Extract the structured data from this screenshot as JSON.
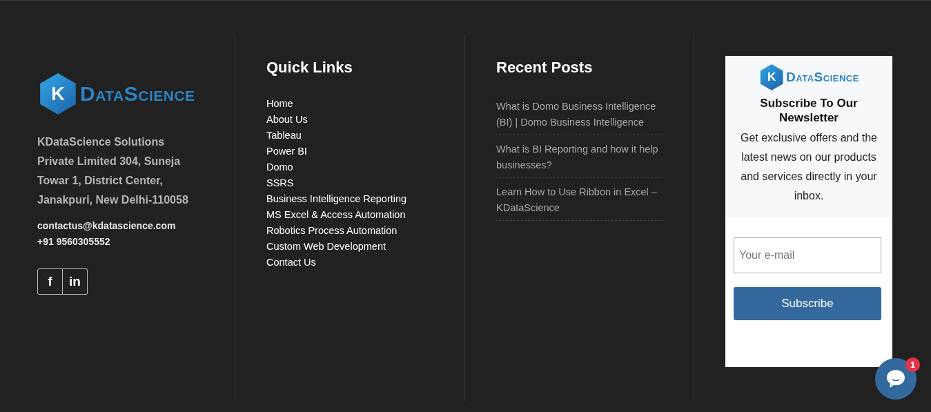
{
  "brand": {
    "mark": "K",
    "wordmark": "DataScience"
  },
  "address": "KDataScience Solutions Private Limited 304, Suneja Towar 1, District Center, Janakpuri, New Delhi-110058",
  "email": "contactus@kdatascience.com",
  "phone": "+91 9560305552",
  "social": [
    "f",
    "in"
  ],
  "quick_links": {
    "title": "Quick Links",
    "items": [
      "Home",
      "About Us",
      "Tableau",
      "Power BI",
      "Domo",
      "SSRS",
      "Business Intelligence Reporting",
      "MS Excel & Access Automation",
      "Robotics Process Automation",
      "Custom Web Development",
      "Contact Us"
    ]
  },
  "recent_posts": {
    "title": "Recent Posts",
    "items": [
      "What is Domo Business Intelligence (BI) | Domo Business Intelligence",
      "What is BI Reporting and how it help businesses?",
      "Learn How to Use Ribbon in Excel – KDataScience"
    ]
  },
  "newsletter": {
    "brand": {
      "mark": "K",
      "wordmark": "DataScience"
    },
    "title": "Subscribe To Our Newsletter",
    "text": "Get exclusive offers and the latest news on our products and services directly in your inbox.",
    "email_placeholder": "Your e-mail",
    "button": "Subscribe"
  },
  "chat": {
    "badge": "1"
  }
}
